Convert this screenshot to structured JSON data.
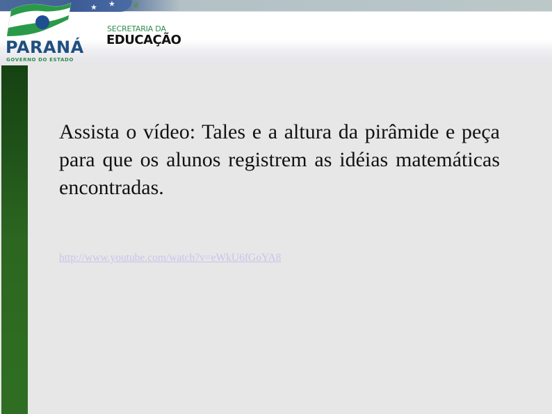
{
  "header": {
    "logo": {
      "name": "PARANÁ",
      "subtitle": "GOVERNO DO ESTADO"
    },
    "department": {
      "line1": "SECRETARIA DA",
      "line2": "EDUCAÇÃO"
    },
    "band_icons": {
      "star": "★",
      "laurel": "❦"
    }
  },
  "colors": {
    "sidebar_green": "#2e6c21",
    "brand_blue": "#1f4f7f",
    "brand_green": "#2d8a4e",
    "flag_circle": "#1f4f91",
    "link": "#c7c4ec",
    "background": "#e7e7e7"
  },
  "content": {
    "paragraph": "Assista o vídeo: Tales e a altura da pirâmide e peça para que os alunos registrem as idéias matemáticas encontradas.",
    "link_text": "http://www.youtube.com/watch?v=eWkU6fGoYA8"
  }
}
